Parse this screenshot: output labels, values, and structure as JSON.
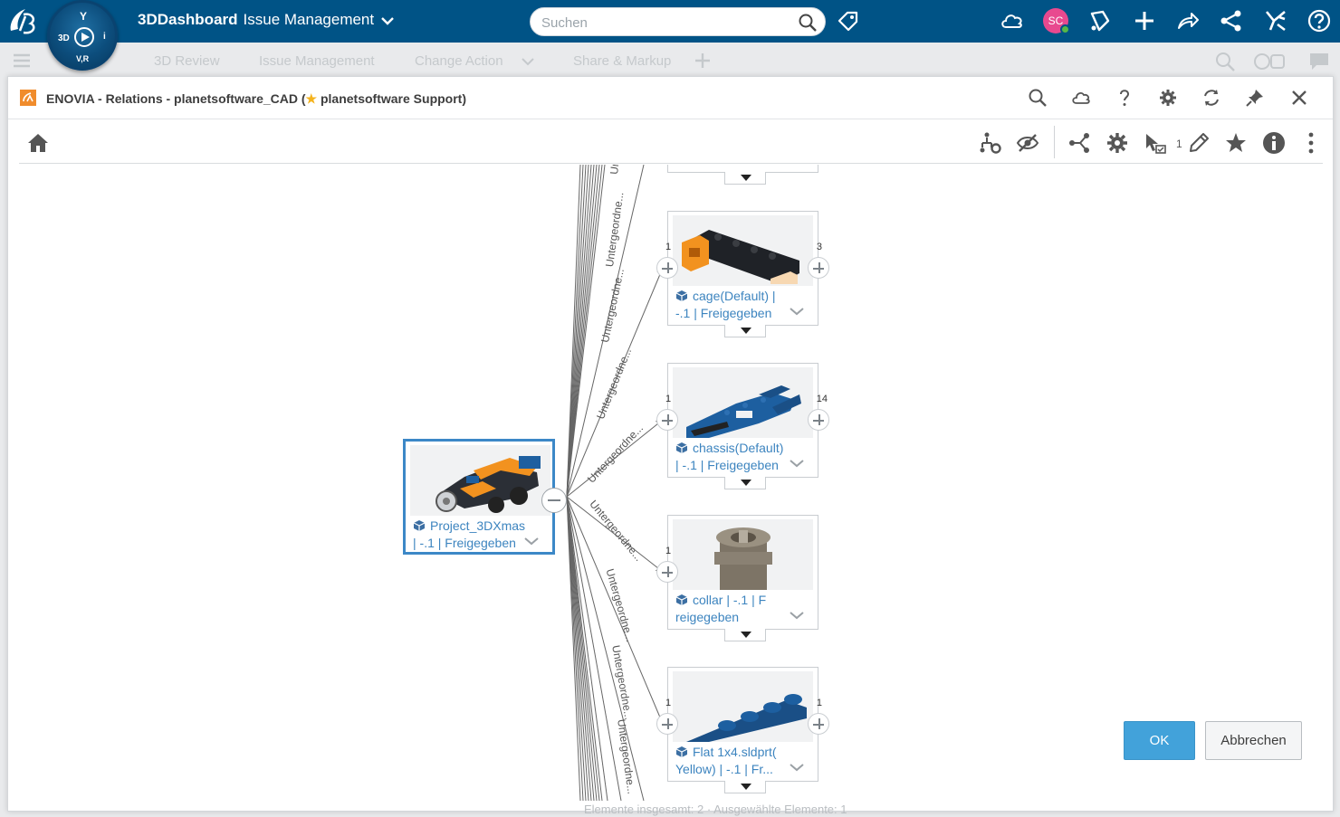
{
  "topbar": {
    "brand": "3DDashboard",
    "app_name": "Issue Management",
    "search_placeholder": "Suchen",
    "avatar_initials": "SC",
    "compass_3d": "3D",
    "compass_vr": "V,R",
    "compass_i": "i",
    "compass_y": "Y"
  },
  "tabs": [
    "3D Review",
    "Issue Management",
    "Change Action",
    "Share & Markup"
  ],
  "dialog": {
    "title_prefix": "ENOVIA - Relations - planetsoftware_CAD (",
    "title_suffix": "planetsoftware Support)",
    "selection_count": "1",
    "ok_label": "OK",
    "cancel_label": "Abbrechen"
  },
  "graph": {
    "root": {
      "title": "Project_3DXmas",
      "meta": "| -.1 | Freigegeben"
    },
    "children": [
      {
        "line1": "cage(Default) |",
        "line2": "-.1 | Freigegeben",
        "left_count": "1",
        "right_count": "3"
      },
      {
        "line1": "chassis(Default)",
        "line2": "| -.1 | Freigegeben",
        "left_count": "1",
        "right_count": "14"
      },
      {
        "line1": "collar | -.1 | F",
        "line2": "reigegeben",
        "left_count": "1",
        "right_count": ""
      },
      {
        "line1": "Flat 1x4.sldprt(",
        "line2": "Yellow) | -.1 | Fr...",
        "left_count": "1",
        "right_count": "1"
      }
    ],
    "edge_label": "Untergeordne...",
    "edge_label_cut": "Unter"
  },
  "footer": "Elemente insgesamt: 2 · Ausgewählte Elemente: 1",
  "colors": {
    "topbar": "#005386",
    "accent": "#3c88c7",
    "link": "#3c84bf",
    "ok": "#42a2da"
  }
}
